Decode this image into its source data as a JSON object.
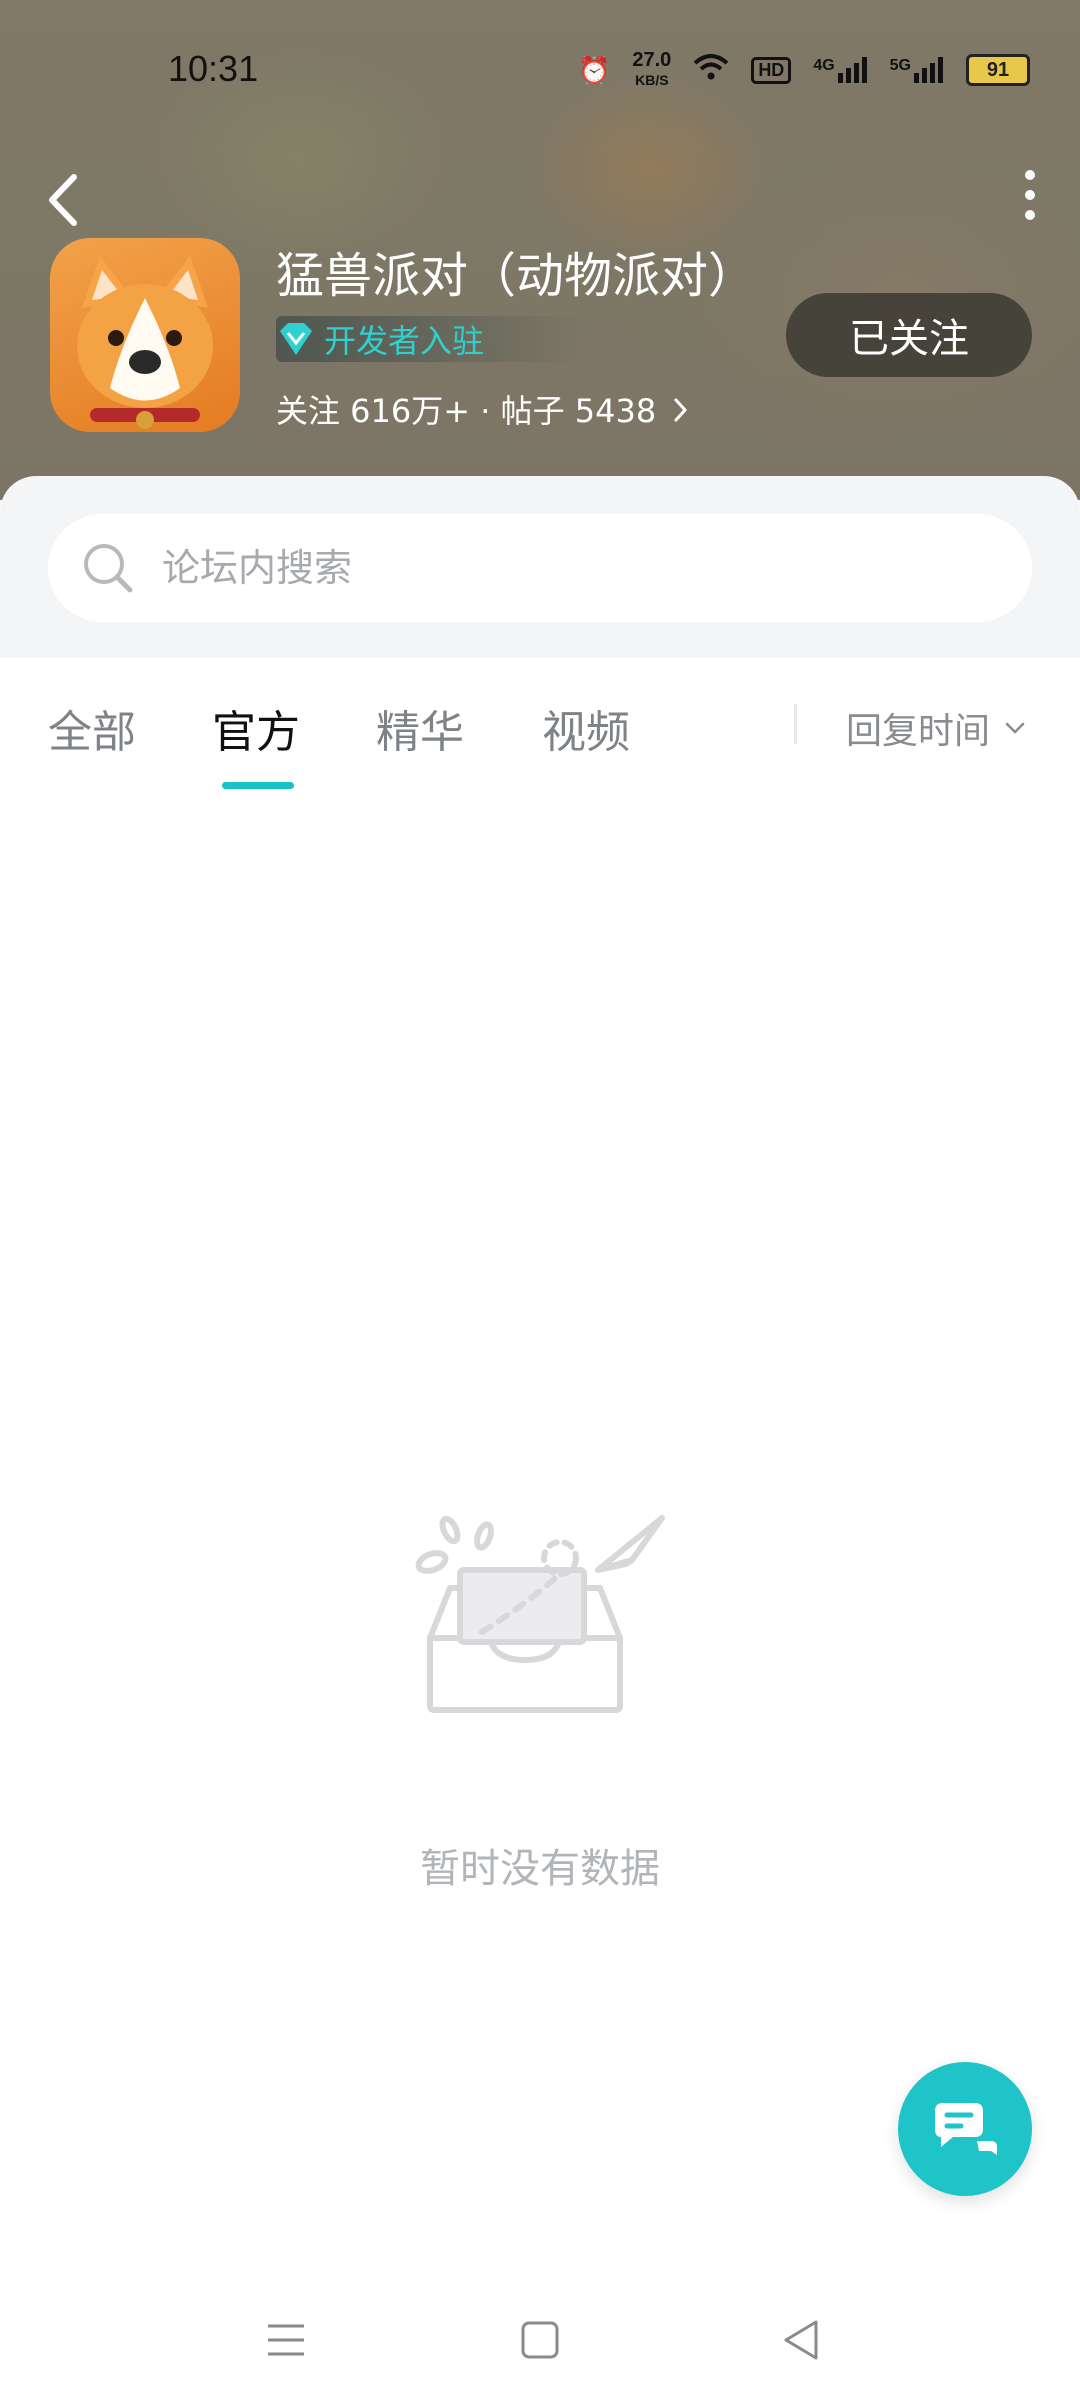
{
  "status_bar": {
    "time": "10:31",
    "net_speed_value": "27.0",
    "net_speed_unit": "KB/S",
    "hd_label": "HD",
    "signal1": "4G",
    "signal2": "5G",
    "battery": "91"
  },
  "header": {
    "title": "猛兽派对（动物派对）",
    "badge": "开发者入驻",
    "stats": "关注 616万+ · 帖子 5438",
    "follow_label": "已关注"
  },
  "search": {
    "placeholder": "论坛内搜索"
  },
  "tabs": [
    {
      "label": "全部",
      "active": false
    },
    {
      "label": "官方",
      "active": true
    },
    {
      "label": "精华",
      "active": false
    },
    {
      "label": "视频",
      "active": false
    }
  ],
  "sort_label": "回复时间",
  "empty_text": "暂时没有数据",
  "colors": {
    "accent": "#1ec4c8",
    "badge": "#2ed0d0"
  }
}
